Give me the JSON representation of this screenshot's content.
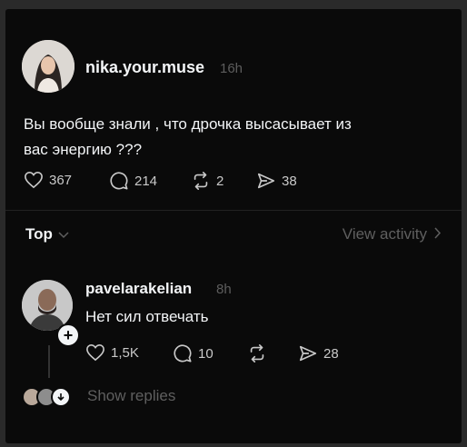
{
  "post": {
    "username": "nika.your.muse",
    "time": "16h",
    "text_line1": "Вы вообще знали , что дрочка высасывает из",
    "text_line2": "вас энергию ???",
    "likes": "367",
    "comments": "214",
    "reposts": "2",
    "shares": "38"
  },
  "sort": {
    "label": "Top"
  },
  "activity": {
    "label": "View activity"
  },
  "reply": {
    "username": "pavelarakelian",
    "time": "8h",
    "text": "Нет сил отвечать",
    "likes": "1,5K",
    "comments": "10",
    "shares": "28"
  },
  "show_replies": "Show replies",
  "colors": {
    "background": "#0a0a0a",
    "text_primary": "#f3f5f7",
    "text_muted": "#5d5d5d",
    "icon": "#c9c9c9"
  },
  "icons": [
    "heart-icon",
    "comment-icon",
    "repost-icon",
    "share-icon",
    "chevron-down-icon",
    "chevron-right-icon",
    "plus-icon",
    "arrow-down-icon"
  ]
}
